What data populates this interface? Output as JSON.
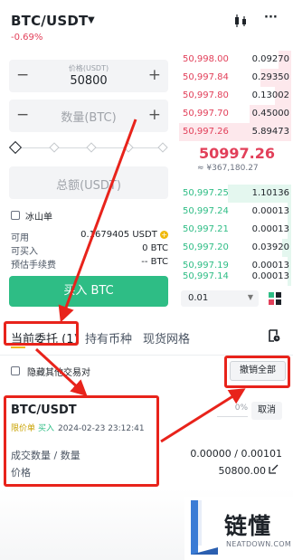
{
  "header": {
    "pair": "BTC/USDT",
    "change": "-0.69%"
  },
  "order_form": {
    "price_label": "价格(USDT)",
    "price_value": "50800",
    "qty_placeholder": "数量(BTC)",
    "total_placeholder": "总额(USDT)",
    "iceberg_label": "冰山单",
    "available_label": "可用",
    "available_value": "0.1679405 USDT",
    "can_buy_label": "可买入",
    "can_buy_value": "0 BTC",
    "fee_label": "预估手续费",
    "fee_value": "-- BTC",
    "buy_button": "买入 BTC"
  },
  "order_book": {
    "asks": [
      {
        "price": "50,998.00",
        "qty": "0.09270"
      },
      {
        "price": "50,997.84",
        "qty": "0.29350"
      },
      {
        "price": "50,997.80",
        "qty": "0.13002"
      },
      {
        "price": "50,997.70",
        "qty": "0.45000"
      },
      {
        "price": "50,997.26",
        "qty": "5.89473"
      }
    ],
    "mid_price": "50997.26",
    "mid_fiat": "≈ ¥367,180.27",
    "bids": [
      {
        "price": "50,997.25",
        "qty": "1.10136"
      },
      {
        "price": "50,997.24",
        "qty": "0.00013"
      },
      {
        "price": "50,997.21",
        "qty": "0.00013"
      },
      {
        "price": "50,997.20",
        "qty": "0.03920"
      },
      {
        "price": "50,997.19",
        "qty": "0.00013"
      },
      {
        "price": "50,997.14",
        "qty": "0.00013"
      }
    ],
    "depth": "0.01"
  },
  "tabs": {
    "open_orders": "当前委托 (1)",
    "holdings": "持有币种",
    "grid": "现货网格"
  },
  "filter": {
    "hide_label": "隐藏其他交易对",
    "cancel_all": "撤销全部"
  },
  "order": {
    "pair": "BTC/USDT",
    "type": "限价单",
    "side": "买入",
    "time": "2024-02-23 23:12:41",
    "progress": "0%",
    "cancel": "取消",
    "filled_label": "成交数量 / 数量",
    "filled_value": "0.00000 / 0.00101",
    "price_label": "价格",
    "price_value": "50800.00"
  },
  "watermark": {
    "name": "链懂",
    "site": "NEATDOWN.COM"
  },
  "colors": {
    "ask": "#e2405a",
    "bid": "#2ebd85",
    "annotation": "#e8231b",
    "accent": "#f0b90b"
  }
}
